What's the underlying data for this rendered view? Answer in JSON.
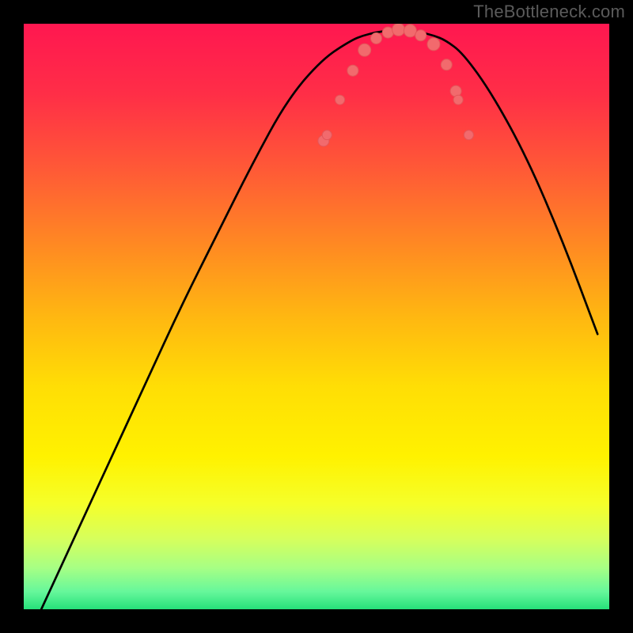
{
  "watermark": "TheBottleneck.com",
  "gradient_stops": [
    {
      "offset": 0.0,
      "color": "#ff1750"
    },
    {
      "offset": 0.12,
      "color": "#ff2e47"
    },
    {
      "offset": 0.25,
      "color": "#ff5a36"
    },
    {
      "offset": 0.38,
      "color": "#ff8a22"
    },
    {
      "offset": 0.5,
      "color": "#ffb711"
    },
    {
      "offset": 0.62,
      "color": "#ffde05"
    },
    {
      "offset": 0.74,
      "color": "#fff200"
    },
    {
      "offset": 0.82,
      "color": "#f5ff2a"
    },
    {
      "offset": 0.88,
      "color": "#d6ff5c"
    },
    {
      "offset": 0.93,
      "color": "#a6ff85"
    },
    {
      "offset": 0.97,
      "color": "#66f79b"
    },
    {
      "offset": 1.0,
      "color": "#26e07a"
    }
  ],
  "curve_color": "#000000",
  "curve_width": 2.7,
  "marker_color_fill": "#f26a6d",
  "marker_color_stroke": "#e35659",
  "chart_data": {
    "type": "line",
    "title": "",
    "xlabel": "",
    "ylabel": "",
    "x": [
      0.03,
      0.09,
      0.15,
      0.21,
      0.27,
      0.33,
      0.39,
      0.45,
      0.51,
      0.56,
      0.58,
      0.6,
      0.62,
      0.64,
      0.66,
      0.68,
      0.7,
      0.72,
      0.75,
      0.8,
      0.86,
      0.92,
      0.98
    ],
    "values": [
      0.0,
      0.13,
      0.26,
      0.39,
      0.52,
      0.64,
      0.76,
      0.87,
      0.94,
      0.972,
      0.98,
      0.985,
      0.988,
      0.99,
      0.988,
      0.985,
      0.98,
      0.972,
      0.95,
      0.88,
      0.77,
      0.63,
      0.47
    ],
    "xlim": [
      0,
      1
    ],
    "ylim": [
      0,
      1
    ],
    "markers_x": [
      0.512,
      0.518,
      0.54,
      0.562,
      0.582,
      0.602,
      0.622,
      0.64,
      0.66,
      0.678,
      0.7,
      0.722,
      0.738,
      0.742,
      0.76
    ],
    "markers_y": [
      0.8,
      0.81,
      0.87,
      0.92,
      0.955,
      0.975,
      0.985,
      0.99,
      0.988,
      0.98,
      0.965,
      0.93,
      0.885,
      0.87,
      0.81
    ],
    "marker_radii": [
      7,
      6,
      6,
      7,
      8,
      7,
      7,
      8,
      8,
      7,
      8,
      7,
      7,
      6,
      6
    ]
  }
}
